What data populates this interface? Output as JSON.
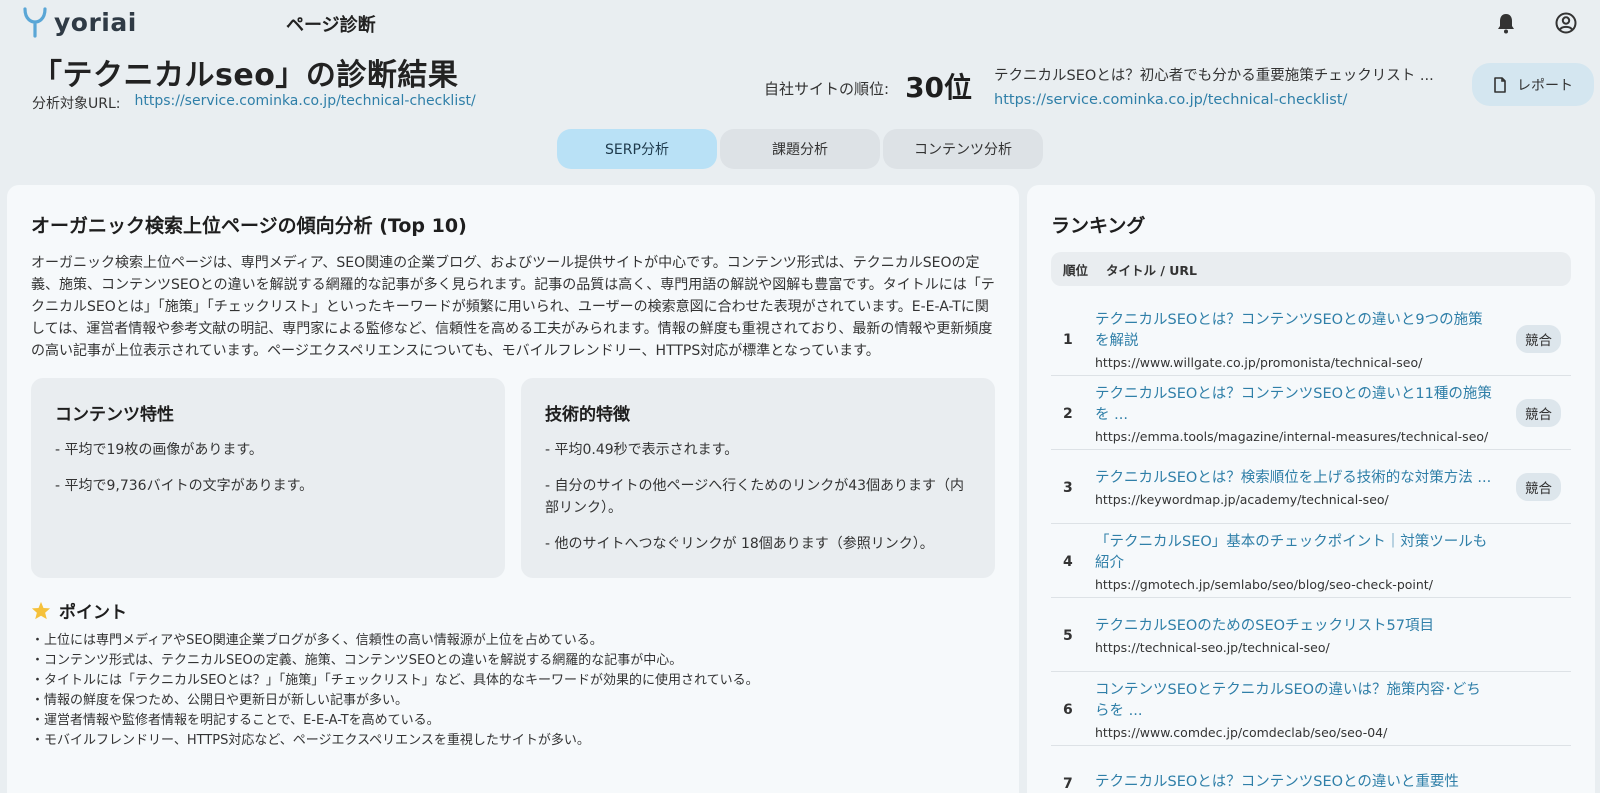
{
  "header": {
    "logo_text": "yoriai",
    "page_heading": "ページ診断",
    "result_title": "「テクニカルseo」の診断結果",
    "url_label": "分析対象URL:",
    "url_value": "https://service.cominka.co.jp/technical-checklist/",
    "own_rank_label": "自社サイトの順位:",
    "own_rank_value": "30位",
    "own_page_title": "テクニカルSEOとは？初心者でも分かる重要施策チェックリスト ...",
    "own_page_url": "https://service.cominka.co.jp/technical-checklist/",
    "report_label": "レポート",
    "icons": [
      "bell-icon",
      "user-icon",
      "document-icon"
    ]
  },
  "tabs": [
    {
      "label": "SERP分析",
      "active": true
    },
    {
      "label": "課題分析",
      "active": false
    },
    {
      "label": "コンテンツ分析",
      "active": false
    }
  ],
  "analysis": {
    "title": "オーガニック検索上位ページの傾向分析 (Top 10)",
    "description": "オーガニック検索上位ページは、専門メディア、SEO関連の企業ブログ、およびツール提供サイトが中心です。コンテンツ形式は、テクニカルSEOの定義、施策、コンテンツSEOとの違いを解説する網羅的な記事が多く見られます。記事の品質は高く、専門用語の解説や図解も豊富です。タイトルには「テクニカルSEOとは」「施策」「チェックリスト」といったキーワードが頻繁に用いられ、ユーザーの検索意図に合わせた表現がされています。E-E-A-Tに関しては、運営者情報や参考文献の明記、専門家による監修など、信頼性を高める工夫がみられます。情報の鮮度も重視されており、最新の情報や更新頻度の高い記事が上位表示されています。ページエクスペリエンスについても、モバイルフレンドリー、HTTPS対応が標準となっています。",
    "content_card": {
      "title": "コンテンツ特性",
      "items": [
        "- 平均で19枚の画像があります。",
        "- 平均で9,736バイトの文字があります。"
      ]
    },
    "tech_card": {
      "title": "技術的特徴",
      "items": [
        "- 平均0.49秒で表示されます。",
        "- 自分のサイトの他ページへ行くためのリンクが43個あります（内部リンク）。",
        "- 他のサイトへつなぐリンクが 18個あります（参照リンク）。"
      ]
    },
    "points_title": "ポイント",
    "points": [
      "・上位には専門メディアやSEO関連企業ブログが多く、信頼性の高い情報源が上位を占めている。",
      "・コンテンツ形式は、テクニカルSEOの定義、施策、コンテンツSEOとの違いを解説する網羅的な記事が中心。",
      "・タイトルには「テクニカルSEOとは？」「施策」「チェックリスト」など、具体的なキーワードが効果的に使用されている。",
      "・情報の鮮度を保つため、公開日や更新日が新しい記事が多い。",
      "・運営者情報や監修者情報を明記することで、E-E-A-Tを高めている。",
      "・モバイルフレンドリー、HTTPS対応など、ページエクスペリエンスを重視したサイトが多い。"
    ]
  },
  "ranking": {
    "title": "ランキング",
    "col_rank": "順位",
    "col_title": "タイトル / URL",
    "rows": [
      {
        "rank": "1",
        "title": "テクニカルSEOとは？コンテンツSEOとの違いと9つの施策を解説",
        "url": "https://www.willgate.co.jp/promonista/technical-seo/",
        "badge": "競合"
      },
      {
        "rank": "2",
        "title": "テクニカルSEOとは？コンテンツSEOとの違いと11種の施策を ...",
        "url": "https://emma.tools/magazine/internal-measures/technical-seo/",
        "badge": "競合"
      },
      {
        "rank": "3",
        "title": "テクニカルSEOとは？検索順位を上げる技術的な対策方法 ...",
        "url": "https://keywordmap.jp/academy/technical-seo/",
        "badge": "競合"
      },
      {
        "rank": "4",
        "title": "「テクニカルSEO」基本のチェックポイント｜対策ツールも紹介",
        "url": "https://gmotech.jp/semlabo/seo/blog/seo-check-point/",
        "badge": ""
      },
      {
        "rank": "5",
        "title": "テクニカルSEOのためのSEOチェックリスト57項目",
        "url": "https://technical-seo.jp/technical-seo/",
        "badge": ""
      },
      {
        "rank": "6",
        "title": "コンテンツSEOとテクニカルSEOの違いは？施策内容･どちらを ...",
        "url": "https://www.comdec.jp/comdeclab/seo/seo-04/",
        "badge": ""
      },
      {
        "rank": "7",
        "title": "テクニカルSEOとは？コンテンツSEOとの違いと重要性",
        "url": "",
        "badge": ""
      }
    ]
  }
}
